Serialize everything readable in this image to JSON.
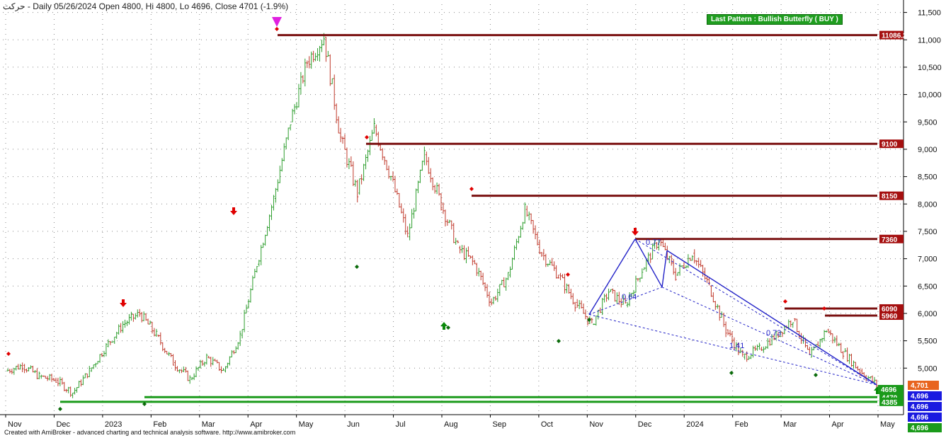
{
  "header": {
    "title": "حرکت - Daily 05/26/2024 Open 4800, Hi 4800, Lo 4696, Close 4701 (-1.9%)"
  },
  "pattern_label": "Last Pattern : Bullish Butterfly ( BUY )",
  "credit": "Created with AmiBroker - advanced charting and technical analysis software. http://www.amibroker.com",
  "colors": {
    "up": "#2e9e2e",
    "down": "#c0392b",
    "resistance": "#7a1010",
    "support": "#1a9a1a",
    "pattern": "#2323c8",
    "magenta": "#e020e0"
  },
  "chart_data": {
    "type": "line",
    "title": "",
    "y_axis": {
      "min": 4150,
      "max": 11650,
      "ticks": [
        5000,
        5500,
        6000,
        6500,
        7000,
        7500,
        8000,
        8500,
        9000,
        9500,
        10000,
        10500,
        11000,
        11500
      ],
      "position": "right"
    },
    "x_axis": {
      "labels": [
        "Nov",
        "Dec",
        "2023",
        "Feb",
        "Mar",
        "Apr",
        "May",
        "Jun",
        "Jul",
        "Aug",
        "Sep",
        "Oct",
        "Nov",
        "Dec",
        "2024",
        "Feb",
        "Mar",
        "Apr",
        "May"
      ]
    },
    "series": [
      {
        "values": [
          {
            "x": "Nov",
            "y": 4950
          },
          {
            "x": "Nov",
            "y": 5050
          },
          {
            "x": "Nov",
            "y": 4850
          },
          {
            "x": "Dec",
            "y": 4780
          },
          {
            "x": "Dec",
            "y": 4550
          },
          {
            "x": "Dec",
            "y": 4950
          },
          {
            "x": "2023",
            "y": 5400
          },
          {
            "x": "2023",
            "y": 5800
          },
          {
            "x": "2023",
            "y": 6000
          },
          {
            "x": "2023",
            "y": 5600
          },
          {
            "x": "Feb",
            "y": 5100
          },
          {
            "x": "Feb",
            "y": 4800
          },
          {
            "x": "Mar",
            "y": 5200
          },
          {
            "x": "Mar",
            "y": 4950
          },
          {
            "x": "Apr",
            "y": 5600
          },
          {
            "x": "Apr",
            "y": 6900
          },
          {
            "x": "Apr",
            "y": 8100
          },
          {
            "x": "Apr",
            "y": 9500
          },
          {
            "x": "May",
            "y": 10600
          },
          {
            "x": "May",
            "y": 11050
          },
          {
            "x": "May",
            "y": 9200
          },
          {
            "x": "May",
            "y": 8200
          },
          {
            "x": "May",
            "y": 9400
          },
          {
            "x": "Jun",
            "y": 8500
          },
          {
            "x": "Jun",
            "y": 7400
          },
          {
            "x": "Jul",
            "y": 8900
          },
          {
            "x": "Jul",
            "y": 8000
          },
          {
            "x": "Jul",
            "y": 7200
          },
          {
            "x": "Aug",
            "y": 6900
          },
          {
            "x": "Aug",
            "y": 6200
          },
          {
            "x": "Aug",
            "y": 6700
          },
          {
            "x": "Sep",
            "y": 7900
          },
          {
            "x": "Sep",
            "y": 7100
          },
          {
            "x": "Oct",
            "y": 6700
          },
          {
            "x": "Oct",
            "y": 6200
          },
          {
            "x": "Nov",
            "y": 5800
          },
          {
            "x": "Nov",
            "y": 6400
          },
          {
            "x": "Nov",
            "y": 6150
          },
          {
            "x": "Dec",
            "y": 6800
          },
          {
            "x": "Dec",
            "y": 7350
          },
          {
            "x": "Dec",
            "y": 6700
          },
          {
            "x": "2024",
            "y": 7100
          },
          {
            "x": "2024",
            "y": 6500
          },
          {
            "x": "2024",
            "y": 5700
          },
          {
            "x": "Feb",
            "y": 5200
          },
          {
            "x": "Feb",
            "y": 5350
          },
          {
            "x": "Mar",
            "y": 5600
          },
          {
            "x": "Mar",
            "y": 5900
          },
          {
            "x": "Apr",
            "y": 5200
          },
          {
            "x": "Apr",
            "y": 5700
          },
          {
            "x": "May",
            "y": 5300
          },
          {
            "x": "May",
            "y": 4950
          },
          {
            "x": "May",
            "y": 4701
          }
        ]
      }
    ],
    "resistance_levels": [
      "11086.2",
      "9100",
      "8150",
      "7360",
      "6090",
      "5960"
    ],
    "support_levels": [
      "4470",
      "4385"
    ],
    "price_labels": [
      {
        "text": "4,701",
        "color": "#e8641e"
      },
      {
        "text": "4696",
        "color": "#1a9a1a"
      },
      {
        "text": "4,696",
        "color": "#1a1ae0"
      },
      {
        "text": "4,696",
        "color": "#1a1ae0"
      },
      {
        "text": "4,696",
        "color": "#1a1ae0"
      },
      {
        "text": "4,696",
        "color": "#1a9a1a"
      }
    ],
    "pattern_ratios": [
      "0.77",
      "0.64",
      "0.73",
      "1.41"
    ],
    "grid": true
  }
}
